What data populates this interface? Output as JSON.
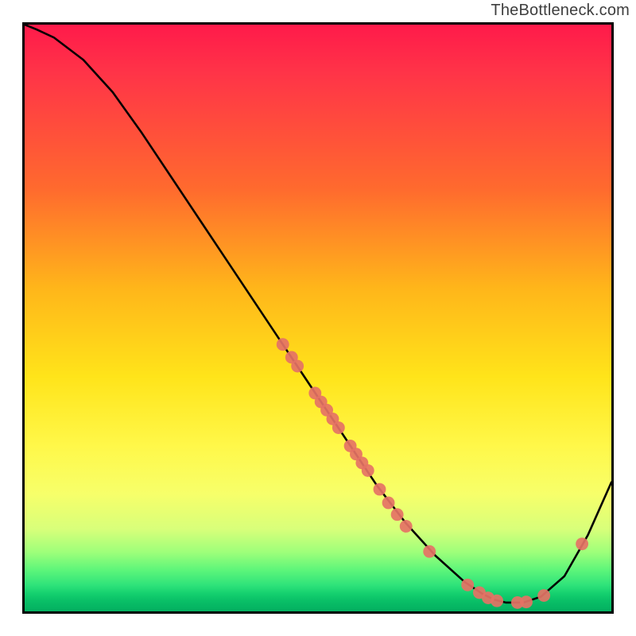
{
  "watermark": "TheBottleneck.com",
  "colors": {
    "curve": "#000000",
    "marker": "#e57265",
    "border": "#000000"
  },
  "chart_data": {
    "type": "line",
    "title": "",
    "xlabel": "",
    "ylabel": "",
    "xlim": [
      0,
      100
    ],
    "ylim": [
      0,
      100
    ],
    "grid": false,
    "legend": false,
    "series": [
      {
        "name": "curve",
        "x": [
          0,
          2,
          5,
          10,
          15,
          20,
          25,
          30,
          35,
          40,
          45,
          50,
          55,
          60,
          65,
          70,
          75,
          78,
          80,
          82,
          85,
          88,
          92,
          96,
          100
        ],
        "y": [
          100,
          99.2,
          97.8,
          94,
          88.5,
          81.5,
          74,
          66.5,
          59,
          51.5,
          44,
          36.5,
          29,
          21.5,
          15,
          9.5,
          5,
          3,
          2,
          1.5,
          1.5,
          2.5,
          6,
          13,
          22
        ]
      }
    ],
    "markers": [
      {
        "x": 44.0,
        "y": 45.5
      },
      {
        "x": 45.5,
        "y": 43.3
      },
      {
        "x": 46.5,
        "y": 41.8
      },
      {
        "x": 49.5,
        "y": 37.2
      },
      {
        "x": 50.5,
        "y": 35.7
      },
      {
        "x": 51.5,
        "y": 34.3
      },
      {
        "x": 52.5,
        "y": 32.8
      },
      {
        "x": 53.5,
        "y": 31.3
      },
      {
        "x": 55.5,
        "y": 28.2
      },
      {
        "x": 56.5,
        "y": 26.8
      },
      {
        "x": 57.5,
        "y": 25.3
      },
      {
        "x": 58.5,
        "y": 24.0
      },
      {
        "x": 60.5,
        "y": 20.8
      },
      {
        "x": 62.0,
        "y": 18.5
      },
      {
        "x": 63.5,
        "y": 16.5
      },
      {
        "x": 65.0,
        "y": 14.5
      },
      {
        "x": 69.0,
        "y": 10.2
      },
      {
        "x": 75.5,
        "y": 4.5
      },
      {
        "x": 77.5,
        "y": 3.2
      },
      {
        "x": 79.0,
        "y": 2.3
      },
      {
        "x": 80.5,
        "y": 1.8
      },
      {
        "x": 84.0,
        "y": 1.5
      },
      {
        "x": 85.5,
        "y": 1.6
      },
      {
        "x": 88.5,
        "y": 2.7
      },
      {
        "x": 95.0,
        "y": 11.5
      }
    ],
    "marker_radius_px": 8
  }
}
